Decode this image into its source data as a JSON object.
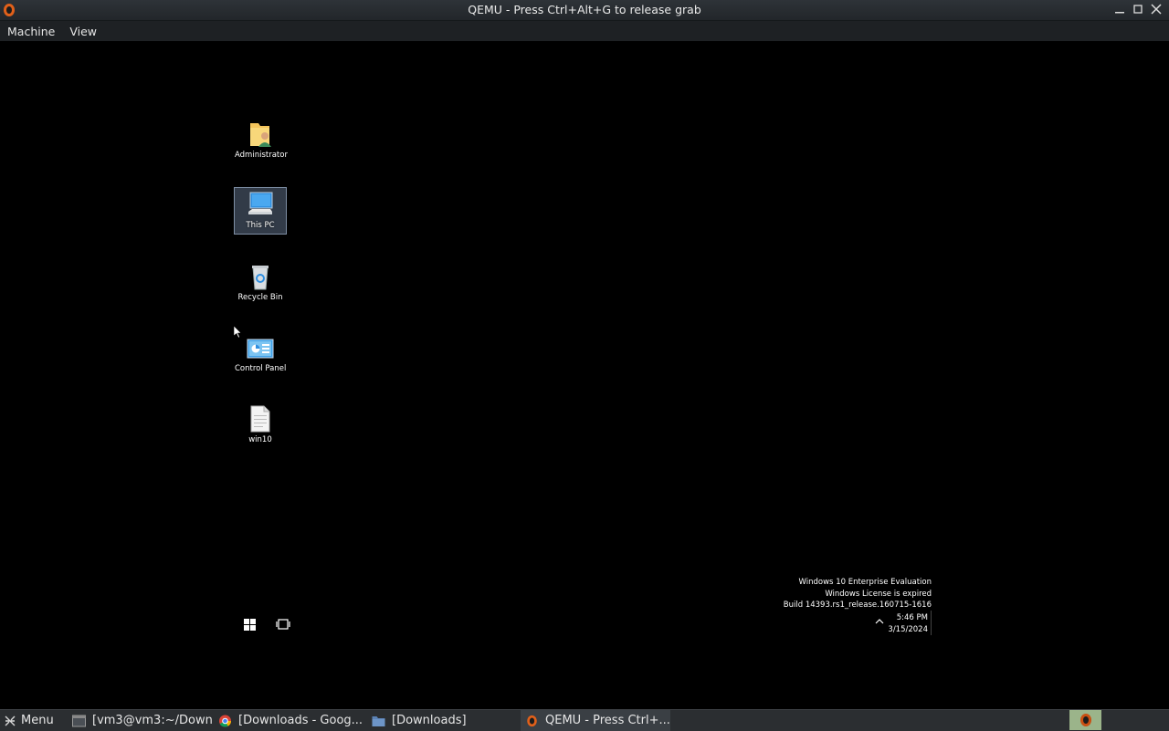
{
  "window": {
    "title": "QEMU - Press Ctrl+Alt+G to release grab",
    "icon": "qemu-icon",
    "controls": [
      "minimize-icon",
      "maximize-icon",
      "close-icon"
    ]
  },
  "menubar": {
    "items": [
      "Machine",
      "View"
    ]
  },
  "desktop": {
    "icons": [
      {
        "label": "Administrator",
        "icon": "user-folder-icon",
        "selected": false
      },
      {
        "label": "This PC",
        "icon": "computer-icon",
        "selected": true
      },
      {
        "label": "Recycle Bin",
        "icon": "recycle-bin-icon",
        "selected": false
      },
      {
        "label": "Control Panel",
        "icon": "control-panel-icon",
        "selected": false
      },
      {
        "label": "win10",
        "icon": "document-icon",
        "selected": false
      }
    ],
    "watermark": {
      "line1": "Windows 10 Enterprise Evaluation",
      "line2": "Windows License is expired",
      "line3": "Build 14393.rs1_release.160715-1616"
    },
    "clock": {
      "time": "5:46 PM",
      "date": "3/15/2024"
    }
  },
  "host_taskbar": {
    "menu_label": "Menu",
    "tasks": [
      {
        "label": "[vm3@vm3:~/Down...",
        "icon": "terminal-icon",
        "active": false
      },
      {
        "label": "[Downloads - Goog...",
        "icon": "chrome-icon",
        "active": false
      },
      {
        "label": "[Downloads]",
        "icon": "folder-icon",
        "active": false
      },
      {
        "label": "QEMU - Press Ctrl+...",
        "icon": "qemu-icon",
        "active": true
      }
    ]
  },
  "colors": {
    "selection": "#6e82a0",
    "host_panel": "#2b2e31",
    "tray_highlight": "#9bb48a"
  }
}
